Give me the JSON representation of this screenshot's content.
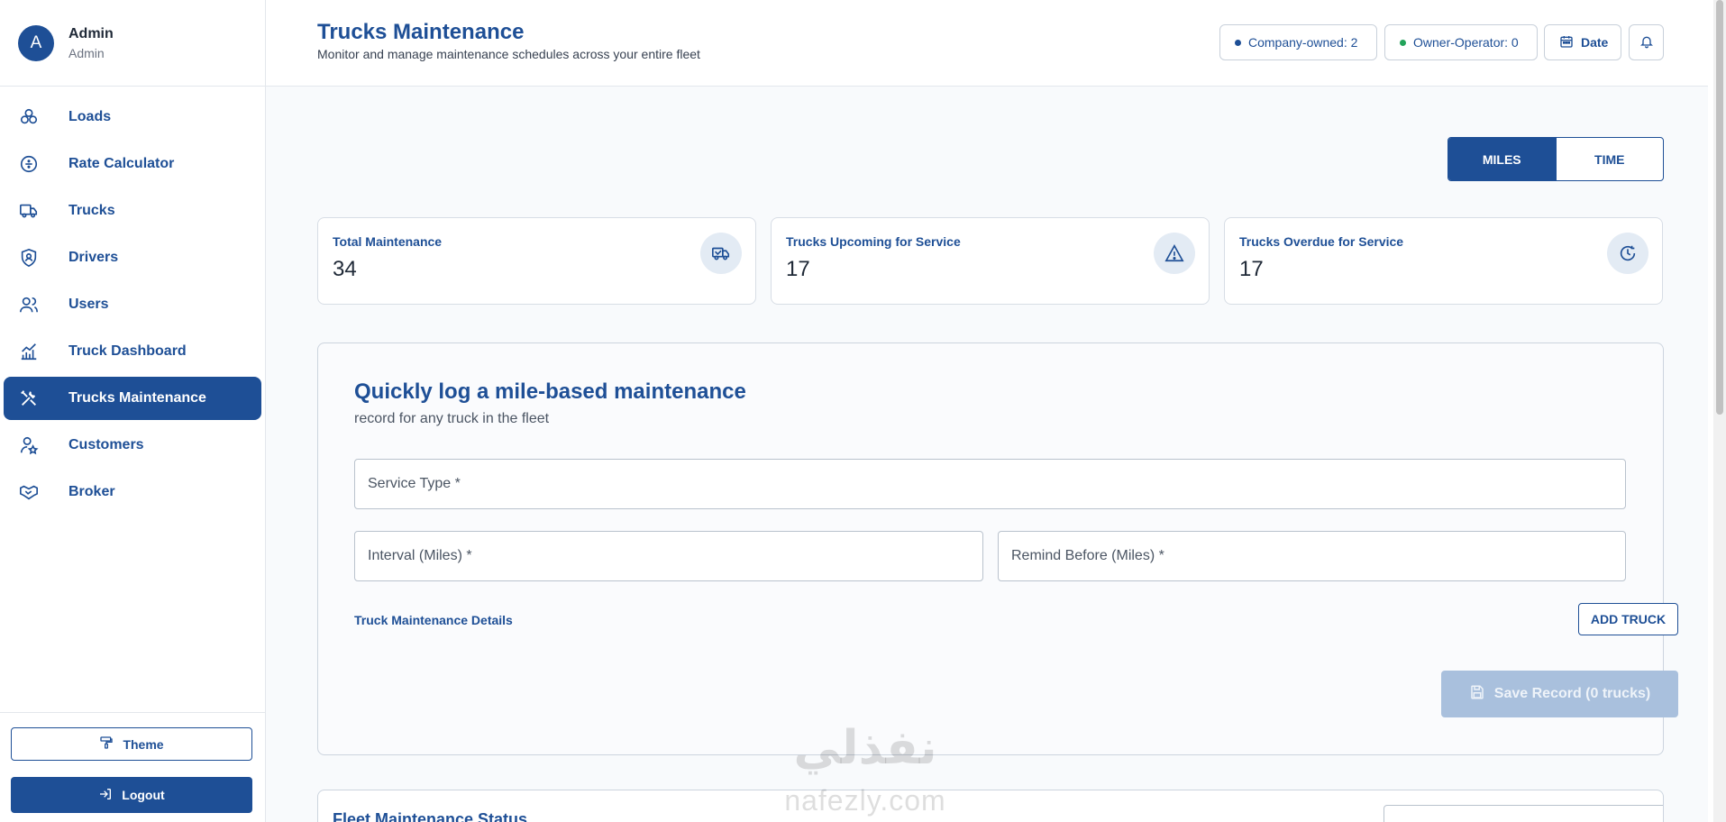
{
  "user": {
    "initial": "A",
    "name": "Admin",
    "role": "Admin"
  },
  "nav": [
    {
      "label": "Loads",
      "icon": "loads-icon"
    },
    {
      "label": "Rate Calculator",
      "icon": "calculator-icon"
    },
    {
      "label": "Trucks",
      "icon": "truck-icon"
    },
    {
      "label": "Drivers",
      "icon": "shield-user-icon"
    },
    {
      "label": "Users",
      "icon": "users-icon"
    },
    {
      "label": "Truck Dashboard",
      "icon": "chart-icon"
    },
    {
      "label": "Trucks Maintenance",
      "icon": "tools-icon",
      "active": true
    },
    {
      "label": "Customers",
      "icon": "user-star-icon"
    },
    {
      "label": "Broker",
      "icon": "handshake-icon"
    }
  ],
  "sidebar_bottom": {
    "theme_label": "Theme",
    "logout_label": "Logout"
  },
  "header": {
    "title": "Trucks Maintenance",
    "subtitle": "Monitor and manage maintenance schedules across your entire fleet",
    "company_owned": "Company-owned: 2",
    "owner_operator": "Owner-Operator: 0",
    "date_label": "Date"
  },
  "toggle": {
    "miles": "MILES",
    "time": "TIME",
    "selected": "MILES"
  },
  "stats": [
    {
      "label": "Total Maintenance",
      "value": "34",
      "icon": "truck-icon"
    },
    {
      "label": "Trucks Upcoming for Service",
      "value": "17",
      "icon": "warning-icon"
    },
    {
      "label": "Trucks Overdue for Service",
      "value": "17",
      "icon": "clock-icon"
    }
  ],
  "form": {
    "title": "Quickly log a mile-based maintenance",
    "subtitle": "record for any truck in the fleet",
    "service_type": "Service Type *",
    "interval": "Interval (Miles) *",
    "remind_before": "Remind Before (Miles) *",
    "details_link": "Truck Maintenance Details",
    "add_truck": "ADD TRUCK",
    "save": "Save Record (0 trucks)"
  },
  "status_section": {
    "title": "Fleet Maintenance Status"
  },
  "watermark": {
    "arabic": "نفذلي",
    "latin": "nafezly.com"
  },
  "colors": {
    "primary": "#1e4f96",
    "company_dot": "#1e4f96",
    "owner_dot": "#22a35a"
  }
}
